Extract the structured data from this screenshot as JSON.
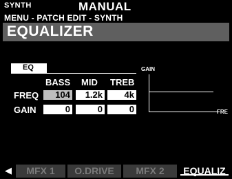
{
  "header": {
    "mode": "SYNTH",
    "title": "MANUAL",
    "breadcrumb": "MENU - PATCH EDIT - SYNTH"
  },
  "page": {
    "title": "EQUALIZER",
    "section_label": "EQ"
  },
  "table": {
    "columns": [
      "BASS",
      "MID",
      "TREB"
    ],
    "rows": [
      {
        "label": "FREQ",
        "values": [
          "104",
          "1.2k",
          "4k"
        ]
      },
      {
        "label": "GAIN",
        "values": [
          "0",
          "0",
          "0"
        ]
      }
    ],
    "selected": {
      "row": 0,
      "col": 0
    }
  },
  "graph": {
    "y_label": "GAIN",
    "x_label": "FRE"
  },
  "tabs": {
    "items": [
      "MFX 1",
      "O.DRIVE",
      "MFX 2",
      "EQUALIZ"
    ],
    "active_index": 3
  }
}
